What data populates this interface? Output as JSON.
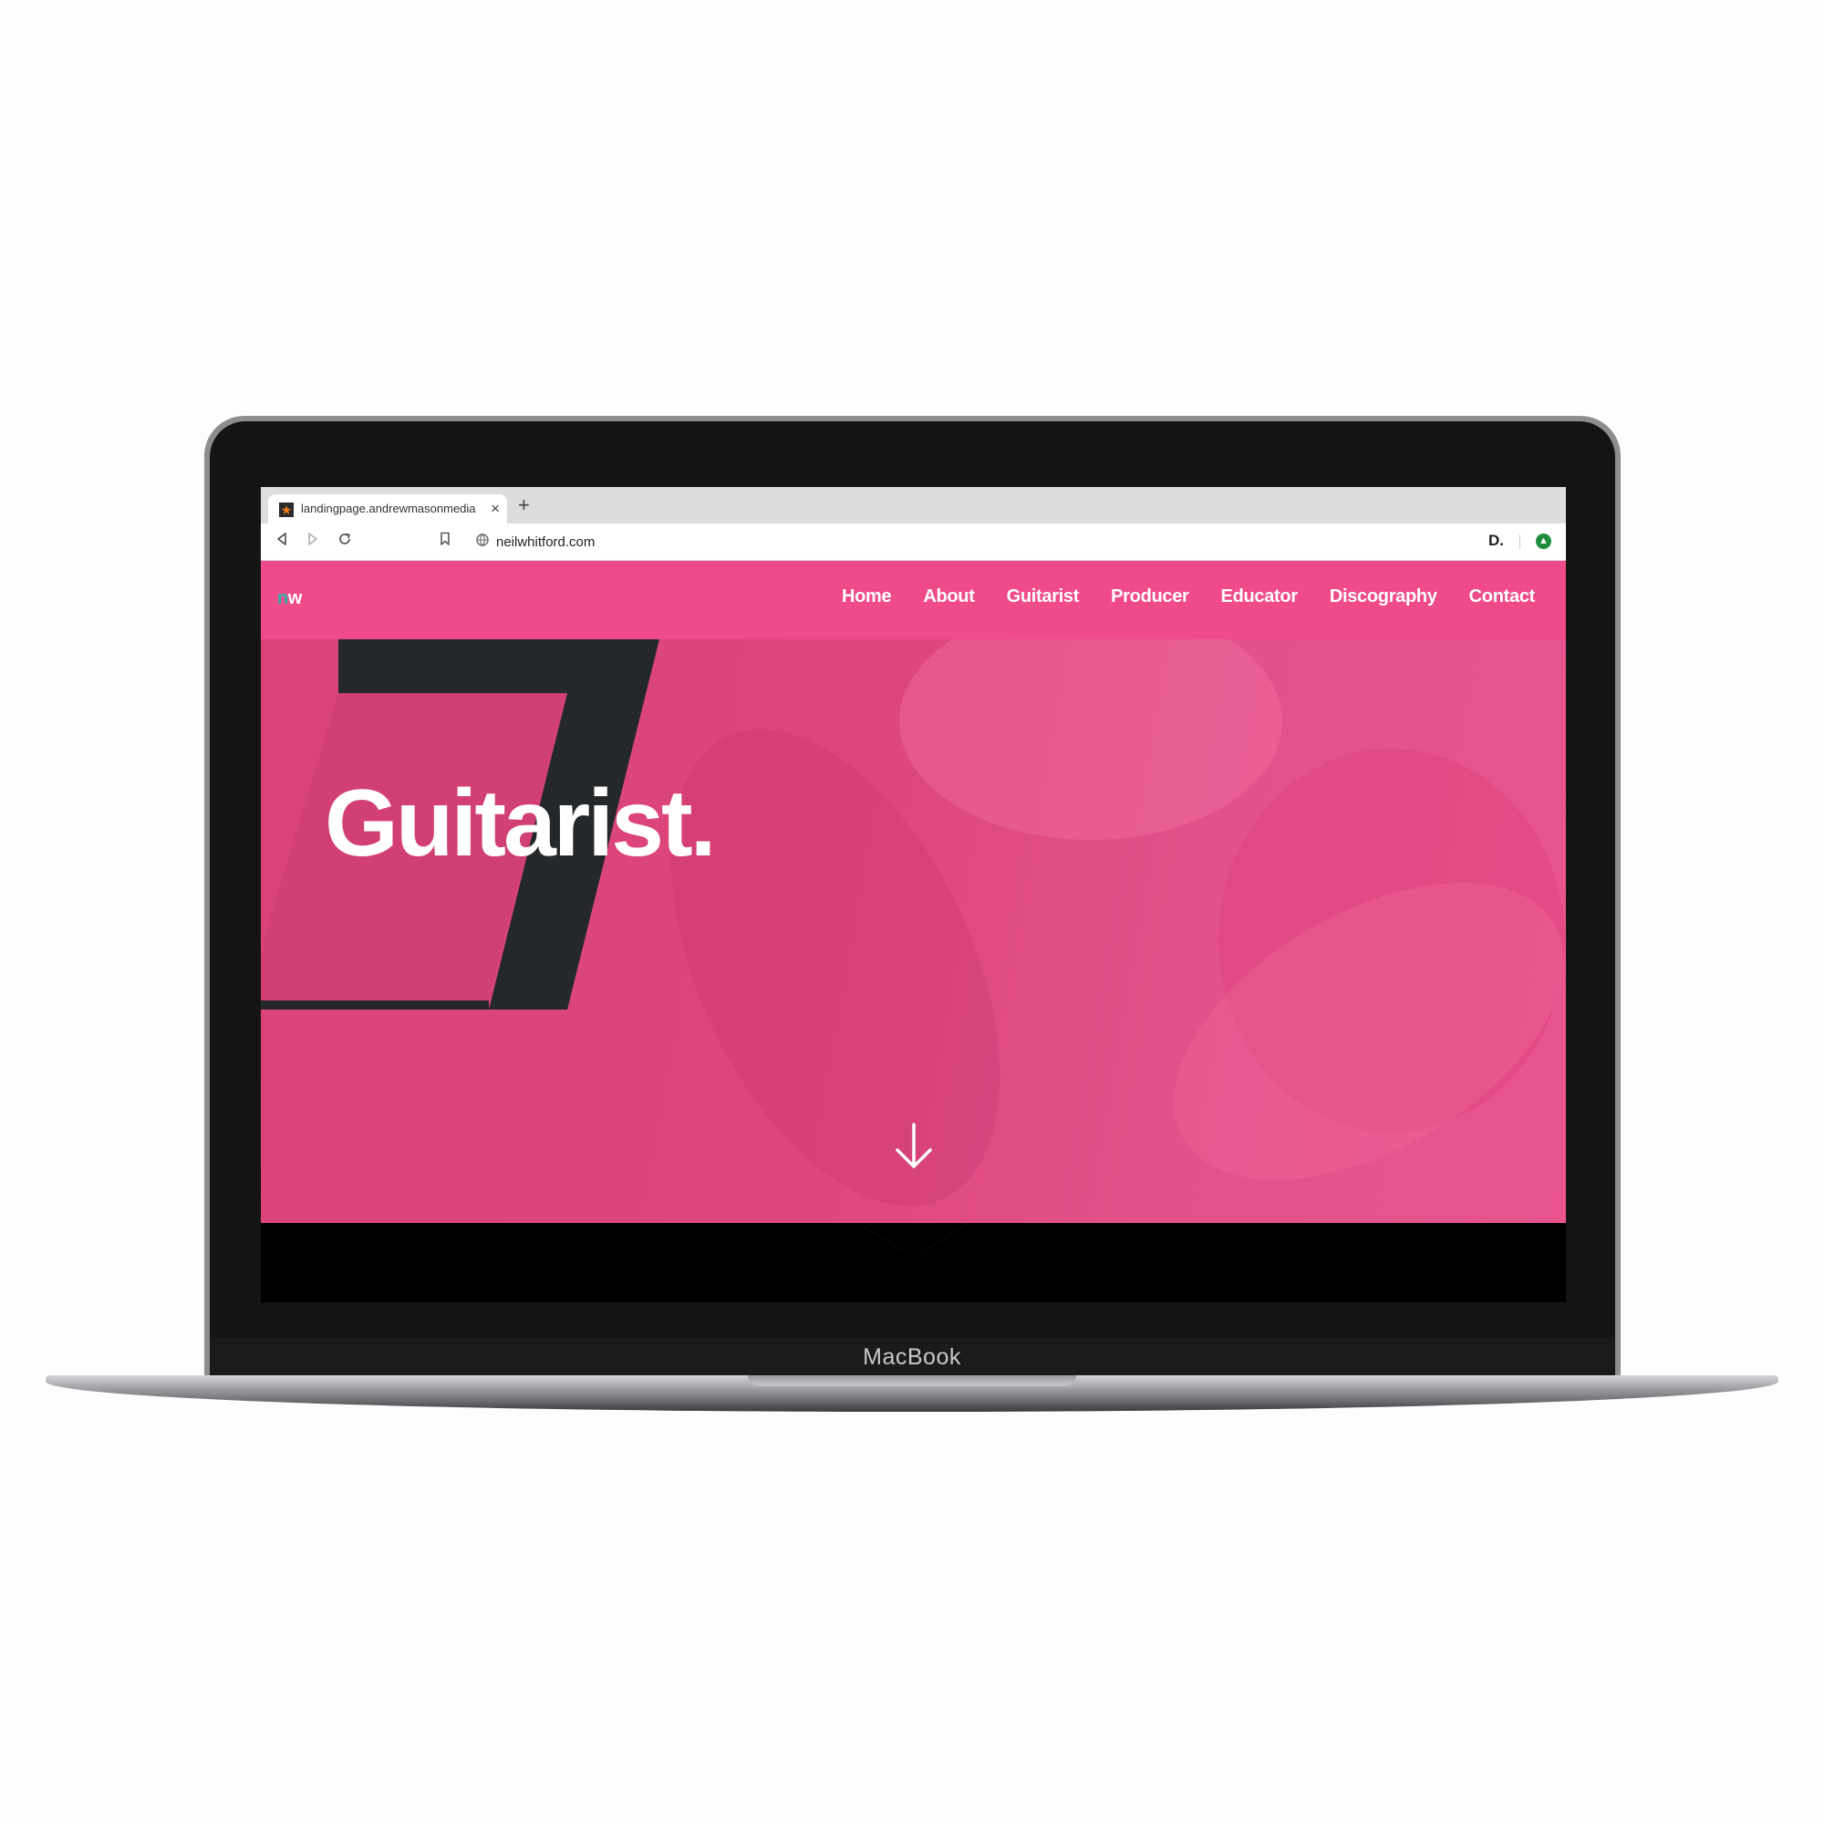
{
  "device": {
    "brand": "MacBook"
  },
  "browser": {
    "tab_title": "landingpage.andrewmasonmedia",
    "tab_close": "×",
    "new_tab": "+",
    "address": "neilwhitford.com",
    "icons": [
      "back-icon",
      "forward-icon",
      "reload-icon",
      "bookmark-icon",
      "globe-icon",
      "extension-d-icon",
      "extension-update-icon"
    ]
  },
  "site": {
    "logo_n": "n",
    "logo_w": "w",
    "nav": [
      "Home",
      "About",
      "Guitarist",
      "Producer",
      "Educator",
      "Discography",
      "Contact"
    ],
    "hero_title": "Guitarist.",
    "hero_number": "7",
    "colors": {
      "accent": "#ef4b8a",
      "hero": "#dd467c",
      "seven": "#25282a",
      "logo_n": "#2bb3a9"
    }
  }
}
